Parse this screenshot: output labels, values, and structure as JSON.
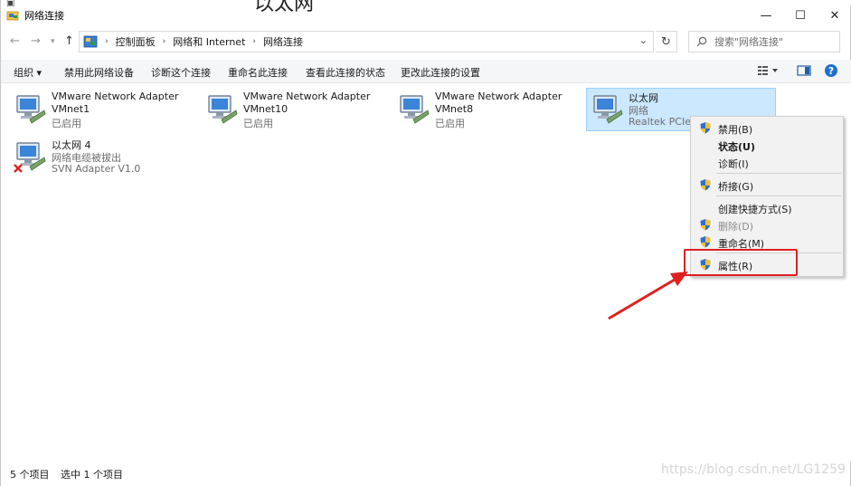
{
  "background": {
    "partial_title": "以太网"
  },
  "window": {
    "title": "网络连接"
  },
  "address": {
    "crumbs": [
      "控制面板",
      "网络和 Internet",
      "网络连接"
    ],
    "search_placeholder": "搜索\"网络连接\""
  },
  "toolbar": {
    "organize": "组织 ▾",
    "disable": "禁用此网络设备",
    "diagnose": "诊断这个连接",
    "rename": "重命名此连接",
    "status": "查看此连接的状态",
    "settings": "更改此连接的设置"
  },
  "adapters": [
    {
      "name": "VMware Network Adapter",
      "line2": "VMnet1",
      "line3": "已启用"
    },
    {
      "name": "VMware Network Adapter",
      "line2": "VMnet10",
      "line3": "已启用"
    },
    {
      "name": "VMware Network Adapter",
      "line2": "VMnet8",
      "line3": "已启用"
    },
    {
      "name": "以太网",
      "line2": "网络",
      "line3": "Realtek PCIe G"
    },
    {
      "name": "以太网 4",
      "line2": "网络电缆被拔出",
      "line3": "SVN Adapter V1.0"
    }
  ],
  "context_menu": {
    "disable": "禁用(B)",
    "status": "状态(U)",
    "diagnose": "诊断(I)",
    "bridge": "桥接(G)",
    "shortcut": "创建快捷方式(S)",
    "delete": "删除(D)",
    "rename": "重命名(M)",
    "properties": "属性(R)"
  },
  "status": {
    "count": "5 个项目",
    "selected": "选中 1 个项目"
  },
  "watermark": "https://blog.csdn.net/LG1259",
  "colors": {
    "accent": "#0078d7",
    "selection": "#cce8ff",
    "highlight": "#e02020"
  }
}
